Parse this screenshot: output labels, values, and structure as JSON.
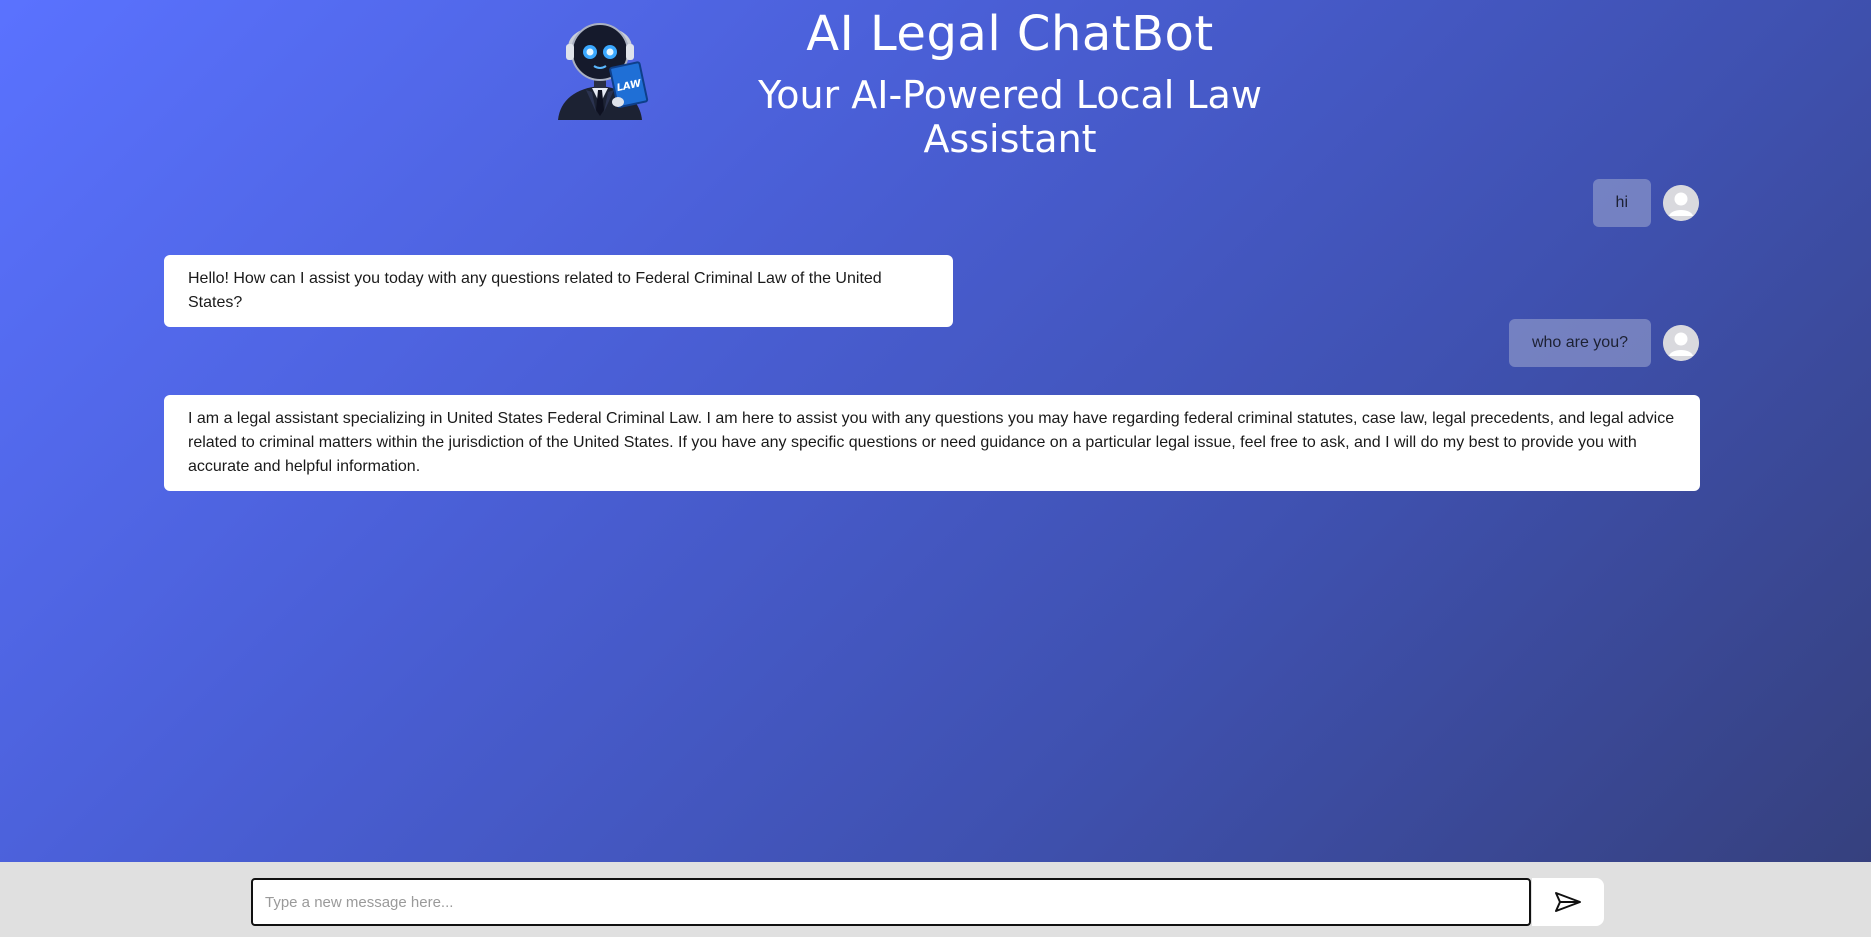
{
  "header": {
    "title": "AI Legal ChatBot",
    "subtitle": "Your AI-Powered Local Law Assistant",
    "logo_icon": "robot-lawyer-logo-icon",
    "logo_book_text": "LAW"
  },
  "chat": {
    "messages": [
      {
        "role": "user",
        "text": "hi"
      },
      {
        "role": "bot",
        "text": "Hello! How can I assist you today with any questions related to Federal Criminal Law of the United States?"
      },
      {
        "role": "user",
        "text": "who are you?"
      },
      {
        "role": "bot",
        "text": "I am a legal assistant specializing in United States Federal Criminal Law. I am here to assist you with any questions you may have regarding federal criminal statutes, case law, legal precedents, and legal advice related to criminal matters within the jurisdiction of the United States. If you have any specific questions or need guidance on a particular legal issue, feel free to ask, and I will do my best to provide you with accurate and helpful information."
      }
    ],
    "user_avatar_icon": "user-avatar-icon"
  },
  "composer": {
    "placeholder": "Type a new message here...",
    "value": "",
    "send_icon": "send-icon"
  },
  "colors": {
    "gradient_start": "#5a72ff",
    "gradient_end": "#353f7a",
    "footer_bg": "#e0e0e0",
    "user_bubble": "#8f99c9",
    "bot_bubble": "#ffffff"
  }
}
